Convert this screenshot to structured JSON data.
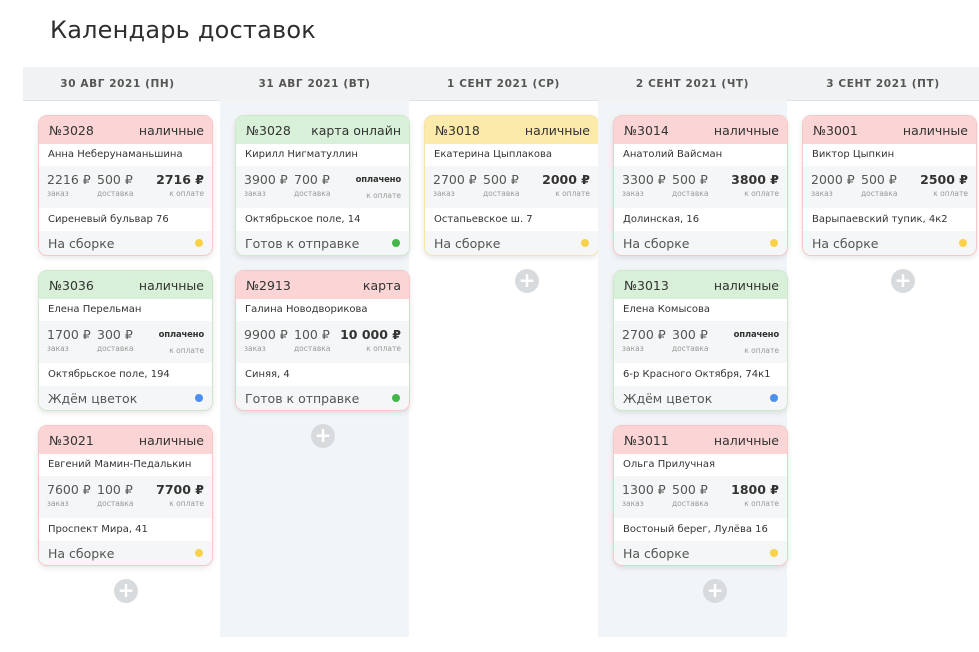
{
  "title": "Календарь доставок",
  "labels": {
    "order": "заказ",
    "delivery": "доставка",
    "to_pay": "к оплате"
  },
  "colors": {
    "yellow_dot": "#f8d24a",
    "green_dot": "#43b649",
    "blue_dot": "#4d8ff0"
  },
  "columns": [
    {
      "date": "30 АВГ 2021 (ПН)",
      "cards": [
        {
          "num": "№3028",
          "payment": "наличные",
          "name": "Анна Неберунаманьшина",
          "order": "2216 ₽",
          "delivery": "500 ₽",
          "to_pay": "2716 ₽",
          "address": "Сиреневый бульвар 76",
          "status": "На сборке"
        },
        {
          "num": "№3036",
          "payment": "наличные",
          "name": "Елена Перельман",
          "order": "1700 ₽",
          "delivery": "300 ₽",
          "to_pay": "оплачено",
          "address": "Октябрьское поле, 194",
          "status": "Ждём цветок"
        },
        {
          "num": "№3021",
          "payment": "наличные",
          "name": "Евгений Мамин-Педалькин",
          "order": "7600 ₽",
          "delivery": "100 ₽",
          "to_pay": "7700 ₽",
          "address": "Проспект Мира, 41",
          "status": "На сборке"
        }
      ]
    },
    {
      "date": "31 АВГ 2021 (ВТ)",
      "cards": [
        {
          "num": "№3028",
          "payment": "карта онлайн",
          "name": "Кирилл Нигматуллин",
          "order": "3900 ₽",
          "delivery": "700 ₽",
          "to_pay": "оплачено",
          "address": "Октябрьское поле, 14",
          "status": "Готов к отправке"
        },
        {
          "num": "№2913",
          "payment": "карта",
          "name": "Галина Новодворикова",
          "order": "9900 ₽",
          "delivery": "100 ₽",
          "to_pay": "10 000 ₽",
          "address": "Синяя, 4",
          "status": "Готов к отправке"
        }
      ]
    },
    {
      "date": "1 СЕНТ 2021 (СР)",
      "cards": [
        {
          "num": "№3018",
          "payment": "наличные",
          "name": "Екатерина Цыплакова",
          "order": "2700 ₽",
          "delivery": "500 ₽",
          "to_pay": "2000 ₽",
          "address": "Остапьевское ш. 7",
          "status": "На сборке"
        }
      ]
    },
    {
      "date": "2 СЕНТ 2021 (ЧТ)",
      "cards": [
        {
          "num": "№3014",
          "payment": "наличные",
          "name": "Анатолий Вайсман",
          "order": "3300 ₽",
          "delivery": "500 ₽",
          "to_pay": "3800 ₽",
          "address": "Долинская, 16",
          "status": "На сборке"
        },
        {
          "num": "№3013",
          "payment": "наличные",
          "name": "Елена Комысова",
          "order": "2700 ₽",
          "delivery": "300 ₽",
          "to_pay": "оплачено",
          "address": "6-р Красного Октября, 74к1",
          "status": "Ждём цветок"
        },
        {
          "num": "№3011",
          "payment": "наличные",
          "name": "Ольга Прилучная",
          "order": "1300 ₽",
          "delivery": "500 ₽",
          "to_pay": "1800 ₽",
          "address": "Востоный берег, Лулёва 16",
          "status": "На сборке"
        }
      ]
    },
    {
      "date": "3 СЕНТ 2021 (ПТ)",
      "cards": [
        {
          "num": "№3001",
          "payment": "наличные",
          "name": "Виктор Цыпкин",
          "order": "2000 ₽",
          "delivery": "500 ₽",
          "to_pay": "2500 ₽",
          "address": "Варыпаевский тупик, 4к2",
          "status": "На сборке"
        }
      ]
    }
  ]
}
